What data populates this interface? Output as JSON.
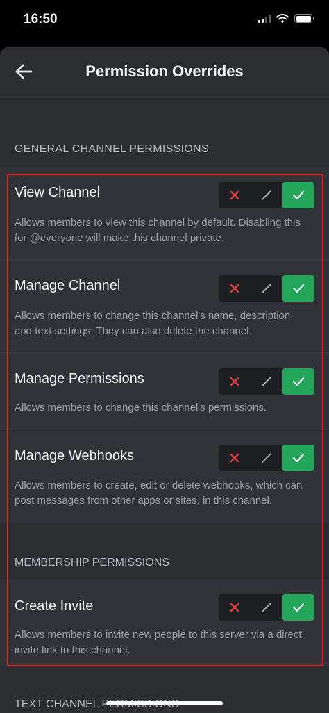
{
  "status_bar": {
    "time": "16:50"
  },
  "header": {
    "title": "Permission Overrides"
  },
  "sections": {
    "general": "GENERAL CHANNEL PERMISSIONS",
    "membership": "MEMBERSHIP PERMISSIONS",
    "text": "TEXT CHANNEL PERMISSIONS"
  },
  "permissions": [
    {
      "name": "View Channel",
      "description": "Allows members to view this channel by default. Disabling this for @everyone will make this channel private.",
      "state": "allow"
    },
    {
      "name": "Manage Channel",
      "description": "Allows members to change this channel's name, description and text settings. They can also delete the channel.",
      "state": "allow"
    },
    {
      "name": "Manage Permissions",
      "description": "Allows members to change this channel's permissions.",
      "state": "allow"
    },
    {
      "name": "Manage Webhooks",
      "description": "Allows members to create, edit or delete webhooks, which can post messages from other apps or sites, in this channel.",
      "state": "allow"
    },
    {
      "name": "Create Invite",
      "description": "Allows members to invite new people to this server via a direct invite link to this channel.",
      "state": "allow"
    }
  ],
  "colors": {
    "deny": "#f23f43",
    "allow": "#23a55a",
    "highlight": "#e0262f"
  },
  "icons": {
    "back": "arrow-left-icon",
    "deny": "x-icon",
    "neutral": "slash-icon",
    "allow": "check-icon"
  }
}
